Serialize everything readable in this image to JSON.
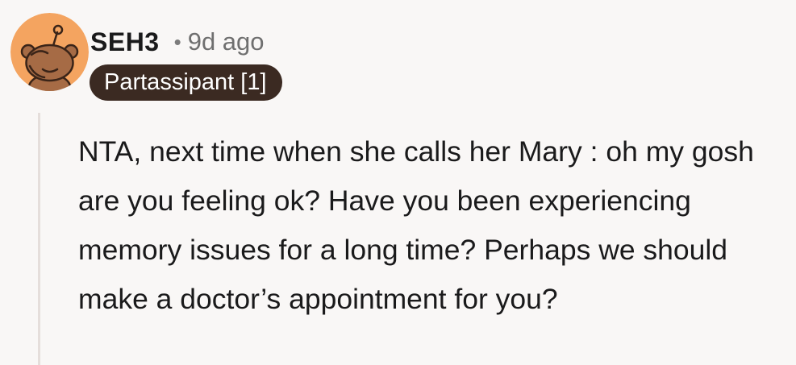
{
  "comment": {
    "author": "SEH3",
    "separator": "•",
    "timestamp": "9d ago",
    "flair": "Partassipant [1]",
    "body": "NTA, next time when she calls her Mary : oh my gosh are you feeling ok? Have you been experiencing memory issues for a long time? Perhaps we should make a doctor’s appointment for you?"
  },
  "avatar": {
    "icon": "snoo-avatar-icon",
    "background_color": "#f4a460",
    "figure_color": "#a66b45"
  },
  "colors": {
    "page_background": "#f9f7f6",
    "flair_background": "#3b2a22",
    "flair_text": "#ffffff",
    "thread_line": "#e5dedb",
    "meta_text": "#6f6f6f"
  }
}
